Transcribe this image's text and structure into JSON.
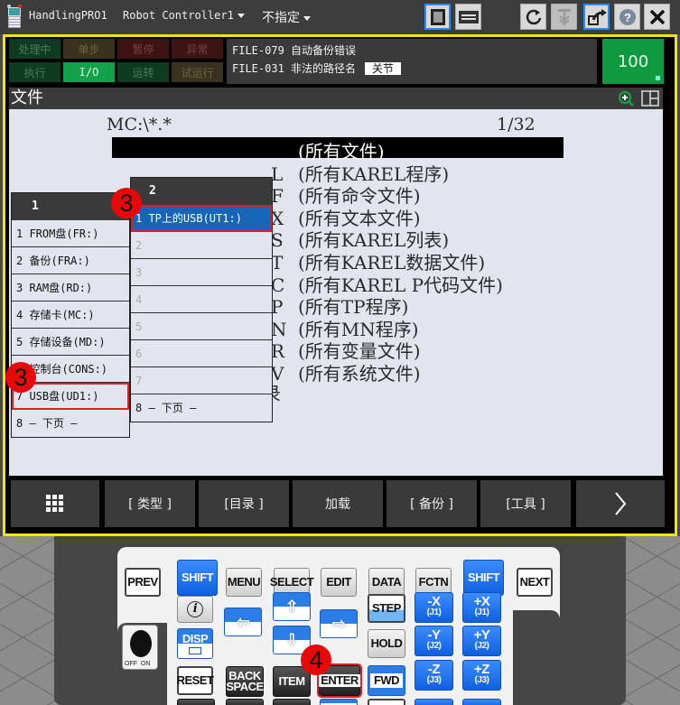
{
  "titlebar": {
    "app_name": "HandlingPRO1",
    "controller": "Robot Controller1",
    "mode": "不指定",
    "buttons": [
      "teach-pendant-icon",
      "keyboard-icon",
      "refresh-icon",
      "robot-icon",
      "export-icon",
      "help-icon",
      "close-icon"
    ]
  },
  "status": {
    "indicators_row1": [
      "处理中",
      "单步",
      "暂停",
      "异常"
    ],
    "indicators_row2": [
      "执行",
      "I/O",
      "运转",
      "试运行"
    ],
    "messages": [
      {
        "code": "FILE-079",
        "text": "自动备份错误"
      },
      {
        "code": "FILE-031",
        "text": "非法的路径名",
        "tag": "关节"
      }
    ],
    "override": "100"
  },
  "screen": {
    "title": "文件",
    "path": "MC:\\*.*",
    "page": "1/32",
    "files": [
      {
        "ext": "",
        "desc": "(所有文件)",
        "selected": true
      },
      {
        "ext": "L",
        "desc": "(所有KAREL程序)"
      },
      {
        "ext": "F",
        "desc": "(所有命令文件)"
      },
      {
        "ext": "X",
        "desc": "(所有文本文件)"
      },
      {
        "ext": "S",
        "desc": "(所有KAREL列表)"
      },
      {
        "ext": "T",
        "desc": "(所有KAREL数据文件)"
      },
      {
        "ext": "C",
        "desc": "(所有KAREL P代码文件)"
      },
      {
        "ext": "P",
        "desc": "(所有TP程序)"
      },
      {
        "ext": "N",
        "desc": "(所有MN程序)"
      },
      {
        "ext": "R",
        "desc": "(所有变量文件)"
      },
      {
        "ext": "V",
        "desc": "(所有系统文件)"
      }
    ],
    "hint": "按目录键，查看目录"
  },
  "popup1": {
    "title": "1",
    "items": [
      "1 FROM盘(FR:)",
      "2 备份(FRA:)",
      "3 RAM盘(RD:)",
      "4 存储卡(MC:)",
      "5 存储设备(MD:)",
      "6 控制台(CONS:)",
      "7 USB盘(UD1:)",
      "8 —  下页  —"
    ],
    "highlighted_index": 6
  },
  "popup2": {
    "title": "2",
    "items": [
      "1 TP上的USB(UT1:)",
      "2",
      "3",
      "4",
      "5",
      "6",
      "7",
      "8 —  下页  —"
    ],
    "selected_index": 0
  },
  "annotations": {
    "step3_a": "3",
    "step3_b": "3",
    "step4": "4"
  },
  "softkeys": [
    "menu-grid-icon",
    "[ 类型 ]",
    "[目录 ]",
    "加载",
    "[ 备份 ]",
    "[工具 ]",
    "next-page-icon"
  ],
  "keypad": {
    "row1": [
      "PREV",
      "SHIFT",
      "MENU",
      "SELECT",
      "EDIT",
      "DATA",
      "FCTN",
      "SHIFT",
      "NEXT"
    ],
    "info": "i",
    "disp": "DISP",
    "step": "STEP",
    "hold": "HOLD",
    "fwd": "FWD",
    "reset": "RESET",
    "backspace": [
      "BACK",
      "SPACE"
    ],
    "item": "ITEM",
    "enter": "ENTER",
    "jog": [
      {
        "axis": "-X",
        "joint": "(J1)"
      },
      {
        "axis": "+X",
        "joint": "(J1)"
      },
      {
        "axis": "-Y",
        "joint": "(J2)"
      },
      {
        "axis": "+Y",
        "joint": "(J2)"
      },
      {
        "axis": "-Z",
        "joint": "(J3)"
      },
      {
        "axis": "+Z",
        "joint": "(J3)"
      }
    ],
    "switch_label": "OFF  ON"
  }
}
